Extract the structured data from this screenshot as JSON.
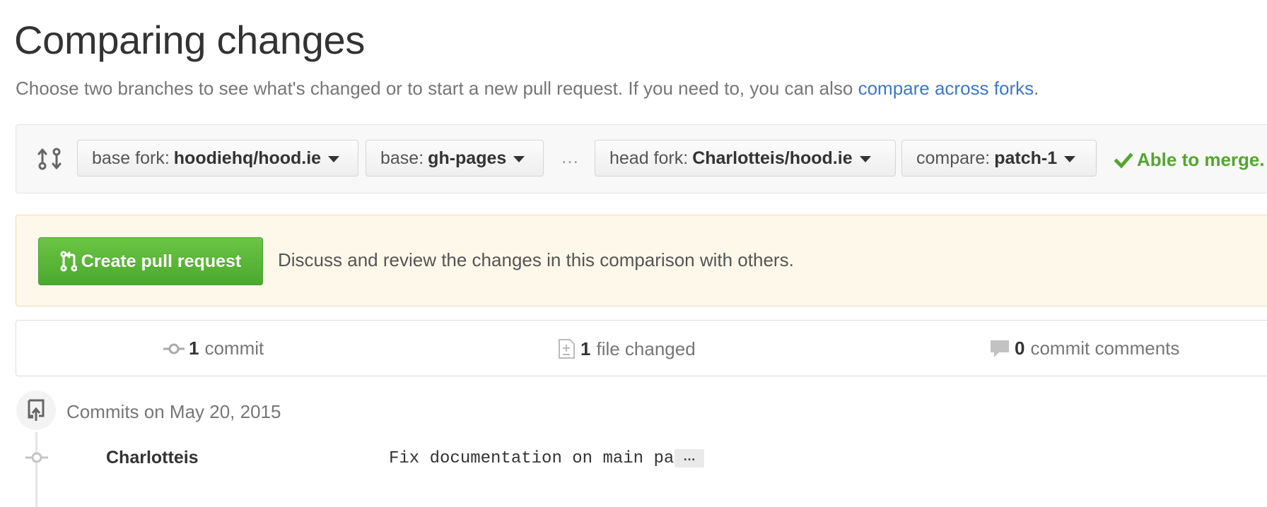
{
  "page": {
    "title": "Comparing changes",
    "subtitle_text": "Choose two branches to see what's changed or to start a new pull request. If you need to, you can also ",
    "subtitle_link": "compare across forks",
    "subtitle_end": "."
  },
  "range": {
    "base_fork_label": "base fork:",
    "base_fork_value": "hoodiehq/hood.ie",
    "base_label": "base:",
    "base_value": "gh-pages",
    "separator": "…",
    "head_fork_label": "head fork:",
    "head_fork_value": "Charlotteis/hood.ie",
    "compare_label": "compare:",
    "compare_value": "patch-1",
    "merge_status": "Able to merge."
  },
  "flash": {
    "button_label": "Create pull request",
    "text": "Discuss and review the changes in this comparison with others."
  },
  "summary": {
    "commits_count": "1",
    "commits_label": "commit",
    "files_count": "1",
    "files_label": "file changed",
    "comments_count": "0",
    "comments_label": "commit comments"
  },
  "commits": {
    "group_title": "Commits on May 20, 2015",
    "items": [
      {
        "author": "Charlotteis",
        "message": "Fix documentation on main page",
        "expander": "…"
      }
    ]
  },
  "colors": {
    "link": "#4078c0",
    "success": "#55a532",
    "button_green": "#6cc644",
    "flash_bg": "#fdf8ea"
  }
}
